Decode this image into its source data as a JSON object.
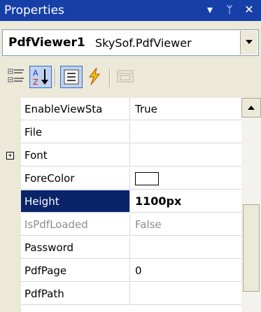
{
  "window": {
    "title": "Properties",
    "controls": {
      "dropdown": "▾",
      "pin": "ᛘ",
      "close": "✕"
    }
  },
  "object_selector": {
    "name": "PdfViewer1",
    "type": "SkySof.PdfViewer"
  },
  "toolbar": {
    "buttons": [
      {
        "icon": "categorized-icon",
        "pressed": false
      },
      {
        "icon": "alphabetical-icon",
        "pressed": true
      },
      {
        "icon": "properties-icon",
        "pressed": true
      },
      {
        "icon": "events-icon",
        "pressed": false
      },
      {
        "icon": "property-pages-icon",
        "pressed": false
      }
    ]
  },
  "properties": [
    {
      "name": "EnableViewSta",
      "value": "True"
    },
    {
      "name": "File",
      "value": ""
    },
    {
      "name": "Font",
      "value": "",
      "expandable": true,
      "expander": "+"
    },
    {
      "name": "ForeColor",
      "value": "",
      "color": "#ffffff"
    },
    {
      "name": "Height",
      "value": "1100px",
      "selected": true,
      "bold": true
    },
    {
      "name": "IsPdfLoaded",
      "value": "False",
      "disabled": true
    },
    {
      "name": "Password",
      "value": ""
    },
    {
      "name": "PdfPage",
      "value": "0"
    },
    {
      "name": "PdfPath",
      "value": ""
    }
  ],
  "colors": {
    "title_bar": "#163fa8",
    "selection": "#0a246a",
    "panel": "#ece9d8"
  }
}
